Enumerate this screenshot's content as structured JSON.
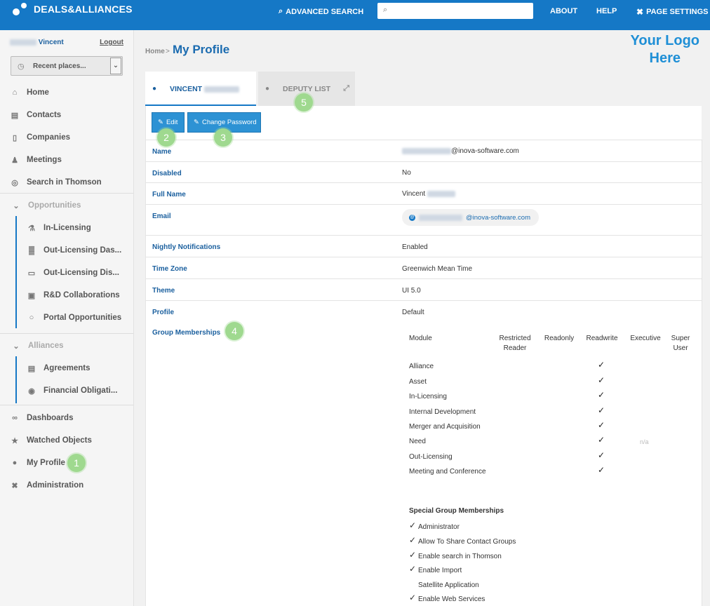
{
  "topbar": {
    "brand": "DEALS&ALLIANCES",
    "advanced_search": "ADVANCED SEARCH",
    "about": "ABOUT",
    "help": "HELP",
    "page_settings": "PAGE SETTINGS",
    "search_placeholder": ""
  },
  "sidebar": {
    "user_name": "Vincent",
    "logout": "Logout",
    "recent_places": "Recent places...",
    "items": [
      {
        "label": "Home",
        "icon": "home-icon"
      },
      {
        "label": "Contacts",
        "icon": "contact-card-icon"
      },
      {
        "label": "Companies",
        "icon": "building-icon"
      },
      {
        "label": "Meetings",
        "icon": "people-icon"
      },
      {
        "label": "Search in Thomson",
        "icon": "globe-icon"
      }
    ],
    "opportunities": {
      "label": "Opportunities",
      "items": [
        {
          "label": "In-Licensing"
        },
        {
          "label": "Out-Licensing Das..."
        },
        {
          "label": "Out-Licensing Dis..."
        },
        {
          "label": "R&D Collaborations"
        },
        {
          "label": "Portal Opportunities"
        }
      ]
    },
    "alliances": {
      "label": "Alliances",
      "items": [
        {
          "label": "Agreements"
        },
        {
          "label": "Financial Obligati..."
        }
      ]
    },
    "bottom_items": [
      {
        "label": "Dashboards"
      },
      {
        "label": "Watched Objects"
      },
      {
        "label": "My Profile"
      },
      {
        "label": "Administration"
      }
    ]
  },
  "main": {
    "breadcrumb_home": "Home",
    "breadcrumb_sep": ">",
    "title": "My Profile",
    "logo_line1": "Your Logo",
    "logo_line2": "Here",
    "tabs": [
      {
        "label": "VINCENT"
      },
      {
        "label": "DEPUTY LIST"
      }
    ],
    "buttons": {
      "edit": "Edit",
      "change_password": "Change Password"
    },
    "fields": [
      {
        "label": "Name",
        "value": "@inova-software.com"
      },
      {
        "label": "Disabled",
        "value": "No"
      },
      {
        "label": "Full Name",
        "value": "Vincent"
      },
      {
        "label": "Email",
        "value": "@inova-software.com"
      },
      {
        "label": "Nightly Notifications",
        "value": "Enabled"
      },
      {
        "label": "Time Zone",
        "value": "Greenwich Mean Time"
      },
      {
        "label": "Theme",
        "value": "UI 5.0"
      },
      {
        "label": "Profile",
        "value": "Default"
      },
      {
        "label": "Group Memberships",
        "value": ""
      }
    ],
    "groups": {
      "headers": [
        "Module",
        "Restricted Reader",
        "Readonly",
        "Readwrite",
        "Executive",
        "Super User"
      ],
      "modules": [
        {
          "name": "Alliance",
          "readwrite": "✓"
        },
        {
          "name": "Asset",
          "readwrite": "✓"
        },
        {
          "name": "In-Licensing",
          "readwrite": "✓"
        },
        {
          "name": "Internal Development",
          "readwrite": "✓"
        },
        {
          "name": "Merger and Acquisition",
          "readwrite": "✓"
        },
        {
          "name": "Need",
          "readwrite": "✓",
          "executive": "n/a"
        },
        {
          "name": "Out-Licensing",
          "readwrite": "✓"
        },
        {
          "name": "Meeting and Conference",
          "readwrite": "✓"
        }
      ],
      "special_title": "Special Group Memberships",
      "special": [
        {
          "label": "Administrator",
          "checked": "✓"
        },
        {
          "label": "Allow To Share Contact Groups",
          "checked": "✓"
        },
        {
          "label": "Enable search in Thomson",
          "checked": "✓"
        },
        {
          "label": "Enable Import",
          "checked": "✓"
        },
        {
          "label": "Satellite Application",
          "checked": ""
        },
        {
          "label": "Enable Web Services",
          "checked": "✓"
        }
      ]
    }
  },
  "annotations": [
    "1",
    "2",
    "3",
    "4",
    "5"
  ],
  "colors": {
    "primary": "#1578c6",
    "badge": "#9fd98f",
    "link": "#1a5f9e"
  }
}
